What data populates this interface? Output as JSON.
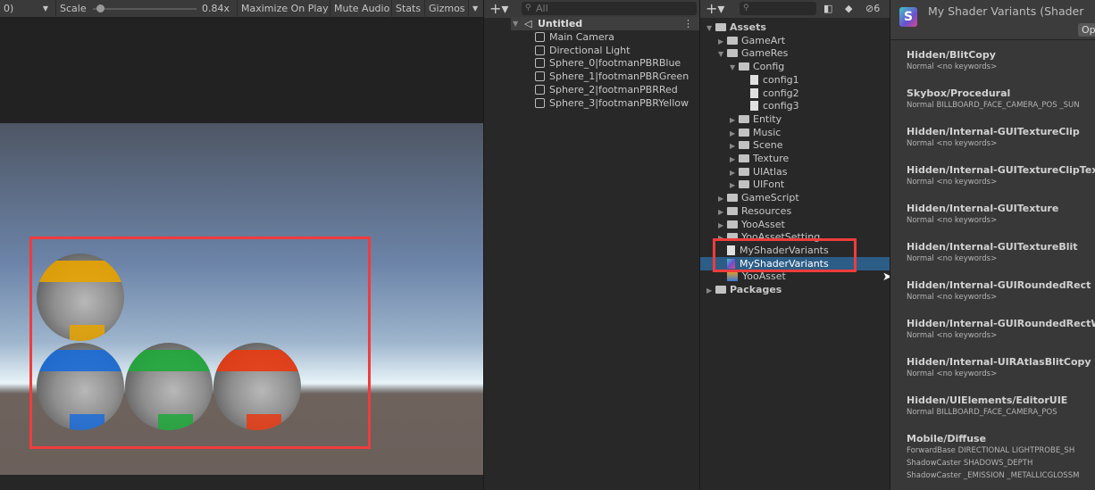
{
  "game_toolbar": {
    "display_fragment": "0)",
    "scale_label": "Scale",
    "scale_value": "0.84x",
    "scale_level": 0.05,
    "maximize": "Maximize On Play",
    "mute": "Mute Audio",
    "stats": "Stats",
    "gizmos": "Gizmos"
  },
  "spheres": [
    {
      "name": "yellow",
      "color": "#e8a400"
    },
    {
      "name": "blue",
      "color": "#1a6cd8"
    },
    {
      "name": "green",
      "color": "#1fa83a"
    },
    {
      "name": "red",
      "color": "#e83a10"
    }
  ],
  "hierarchy": {
    "search_placeholder": "All",
    "scene": "Untitled",
    "items": [
      "Main Camera",
      "Directional Light",
      "Sphere_0|footmanPBRBlue",
      "Sphere_1|footmanPBRGreen",
      "Sphere_2|footmanPBRRed",
      "Sphere_3|footmanPBRYellow"
    ]
  },
  "project": {
    "hidden_count": "6",
    "items": [
      {
        "label": "Assets",
        "level": 0,
        "type": "folder-open",
        "arrow": "▼",
        "bold": true
      },
      {
        "label": "GameArt",
        "level": 1,
        "type": "folder",
        "arrow": "▶"
      },
      {
        "label": "GameRes",
        "level": 1,
        "type": "folder-open",
        "arrow": "▼"
      },
      {
        "label": "Config",
        "level": 2,
        "type": "folder-open",
        "arrow": "▼"
      },
      {
        "label": "config1",
        "level": 3,
        "type": "file"
      },
      {
        "label": "config2",
        "level": 3,
        "type": "file"
      },
      {
        "label": "config3",
        "level": 3,
        "type": "file"
      },
      {
        "label": "Entity",
        "level": 2,
        "type": "folder",
        "arrow": "▶"
      },
      {
        "label": "Music",
        "level": 2,
        "type": "folder",
        "arrow": "▶"
      },
      {
        "label": "Scene",
        "level": 2,
        "type": "folder",
        "arrow": "▶"
      },
      {
        "label": "Texture",
        "level": 2,
        "type": "folder",
        "arrow": "▶"
      },
      {
        "label": "UIAtlas",
        "level": 2,
        "type": "folder",
        "arrow": "▶"
      },
      {
        "label": "UIFont",
        "level": 2,
        "type": "folder",
        "arrow": "▶"
      },
      {
        "label": "GameScript",
        "level": 1,
        "type": "folder",
        "arrow": "▶"
      },
      {
        "label": "Resources",
        "level": 1,
        "type": "folder",
        "arrow": "▶"
      },
      {
        "label": "YooAsset",
        "level": 1,
        "type": "folder",
        "arrow": "▶"
      },
      {
        "label": "YooAssetSetting",
        "level": 1,
        "type": "folder",
        "arrow": "▶"
      },
      {
        "label": "MyShaderVariants",
        "level": 1,
        "type": "file"
      },
      {
        "label": "MyShaderVariants",
        "level": 1,
        "type": "shader-variants",
        "selected": true
      },
      {
        "label": "YooAsset",
        "level": 1,
        "type": "package"
      },
      {
        "label": "Packages",
        "level": 0,
        "type": "folder",
        "arrow": "▶",
        "bold": true
      }
    ]
  },
  "inspector": {
    "title": "My Shader Variants (Shader",
    "open_button": "Op",
    "entries": [
      {
        "title": "Hidden/BlitCopy",
        "lines": [
          "Normal <no keywords>"
        ]
      },
      {
        "title": "Skybox/Procedural",
        "lines": [
          "Normal BILLBOARD_FACE_CAMERA_POS _SUN"
        ]
      },
      {
        "title": "Hidden/Internal-GUITextureClip",
        "lines": [
          "Normal <no keywords>"
        ]
      },
      {
        "title": "Hidden/Internal-GUITextureClipText",
        "lines": [
          "Normal <no keywords>"
        ]
      },
      {
        "title": "Hidden/Internal-GUITexture",
        "lines": [
          "Normal <no keywords>"
        ]
      },
      {
        "title": "Hidden/Internal-GUITextureBlit",
        "lines": [
          "Normal <no keywords>"
        ]
      },
      {
        "title": "Hidden/Internal-GUIRoundedRect",
        "lines": [
          "Normal <no keywords>"
        ]
      },
      {
        "title": "Hidden/Internal-GUIRoundedRectWithC",
        "lines": [
          "Normal <no keywords>"
        ]
      },
      {
        "title": "Hidden/Internal-UIRAtlasBlitCopy",
        "lines": [
          "Normal <no keywords>"
        ]
      },
      {
        "title": "Hidden/UIElements/EditorUIE",
        "lines": [
          "Normal BILLBOARD_FACE_CAMERA_POS"
        ]
      },
      {
        "title": "Mobile/Diffuse",
        "lines": [
          "ForwardBase DIRECTIONAL LIGHTPROBE_SH",
          "ShadowCaster SHADOWS_DEPTH",
          "ShadowCaster _EMISSION _METALLICGLOSSM"
        ]
      }
    ]
  },
  "colors": {
    "selection": "#2c5d87",
    "highlight_box": "#f03c3c"
  }
}
